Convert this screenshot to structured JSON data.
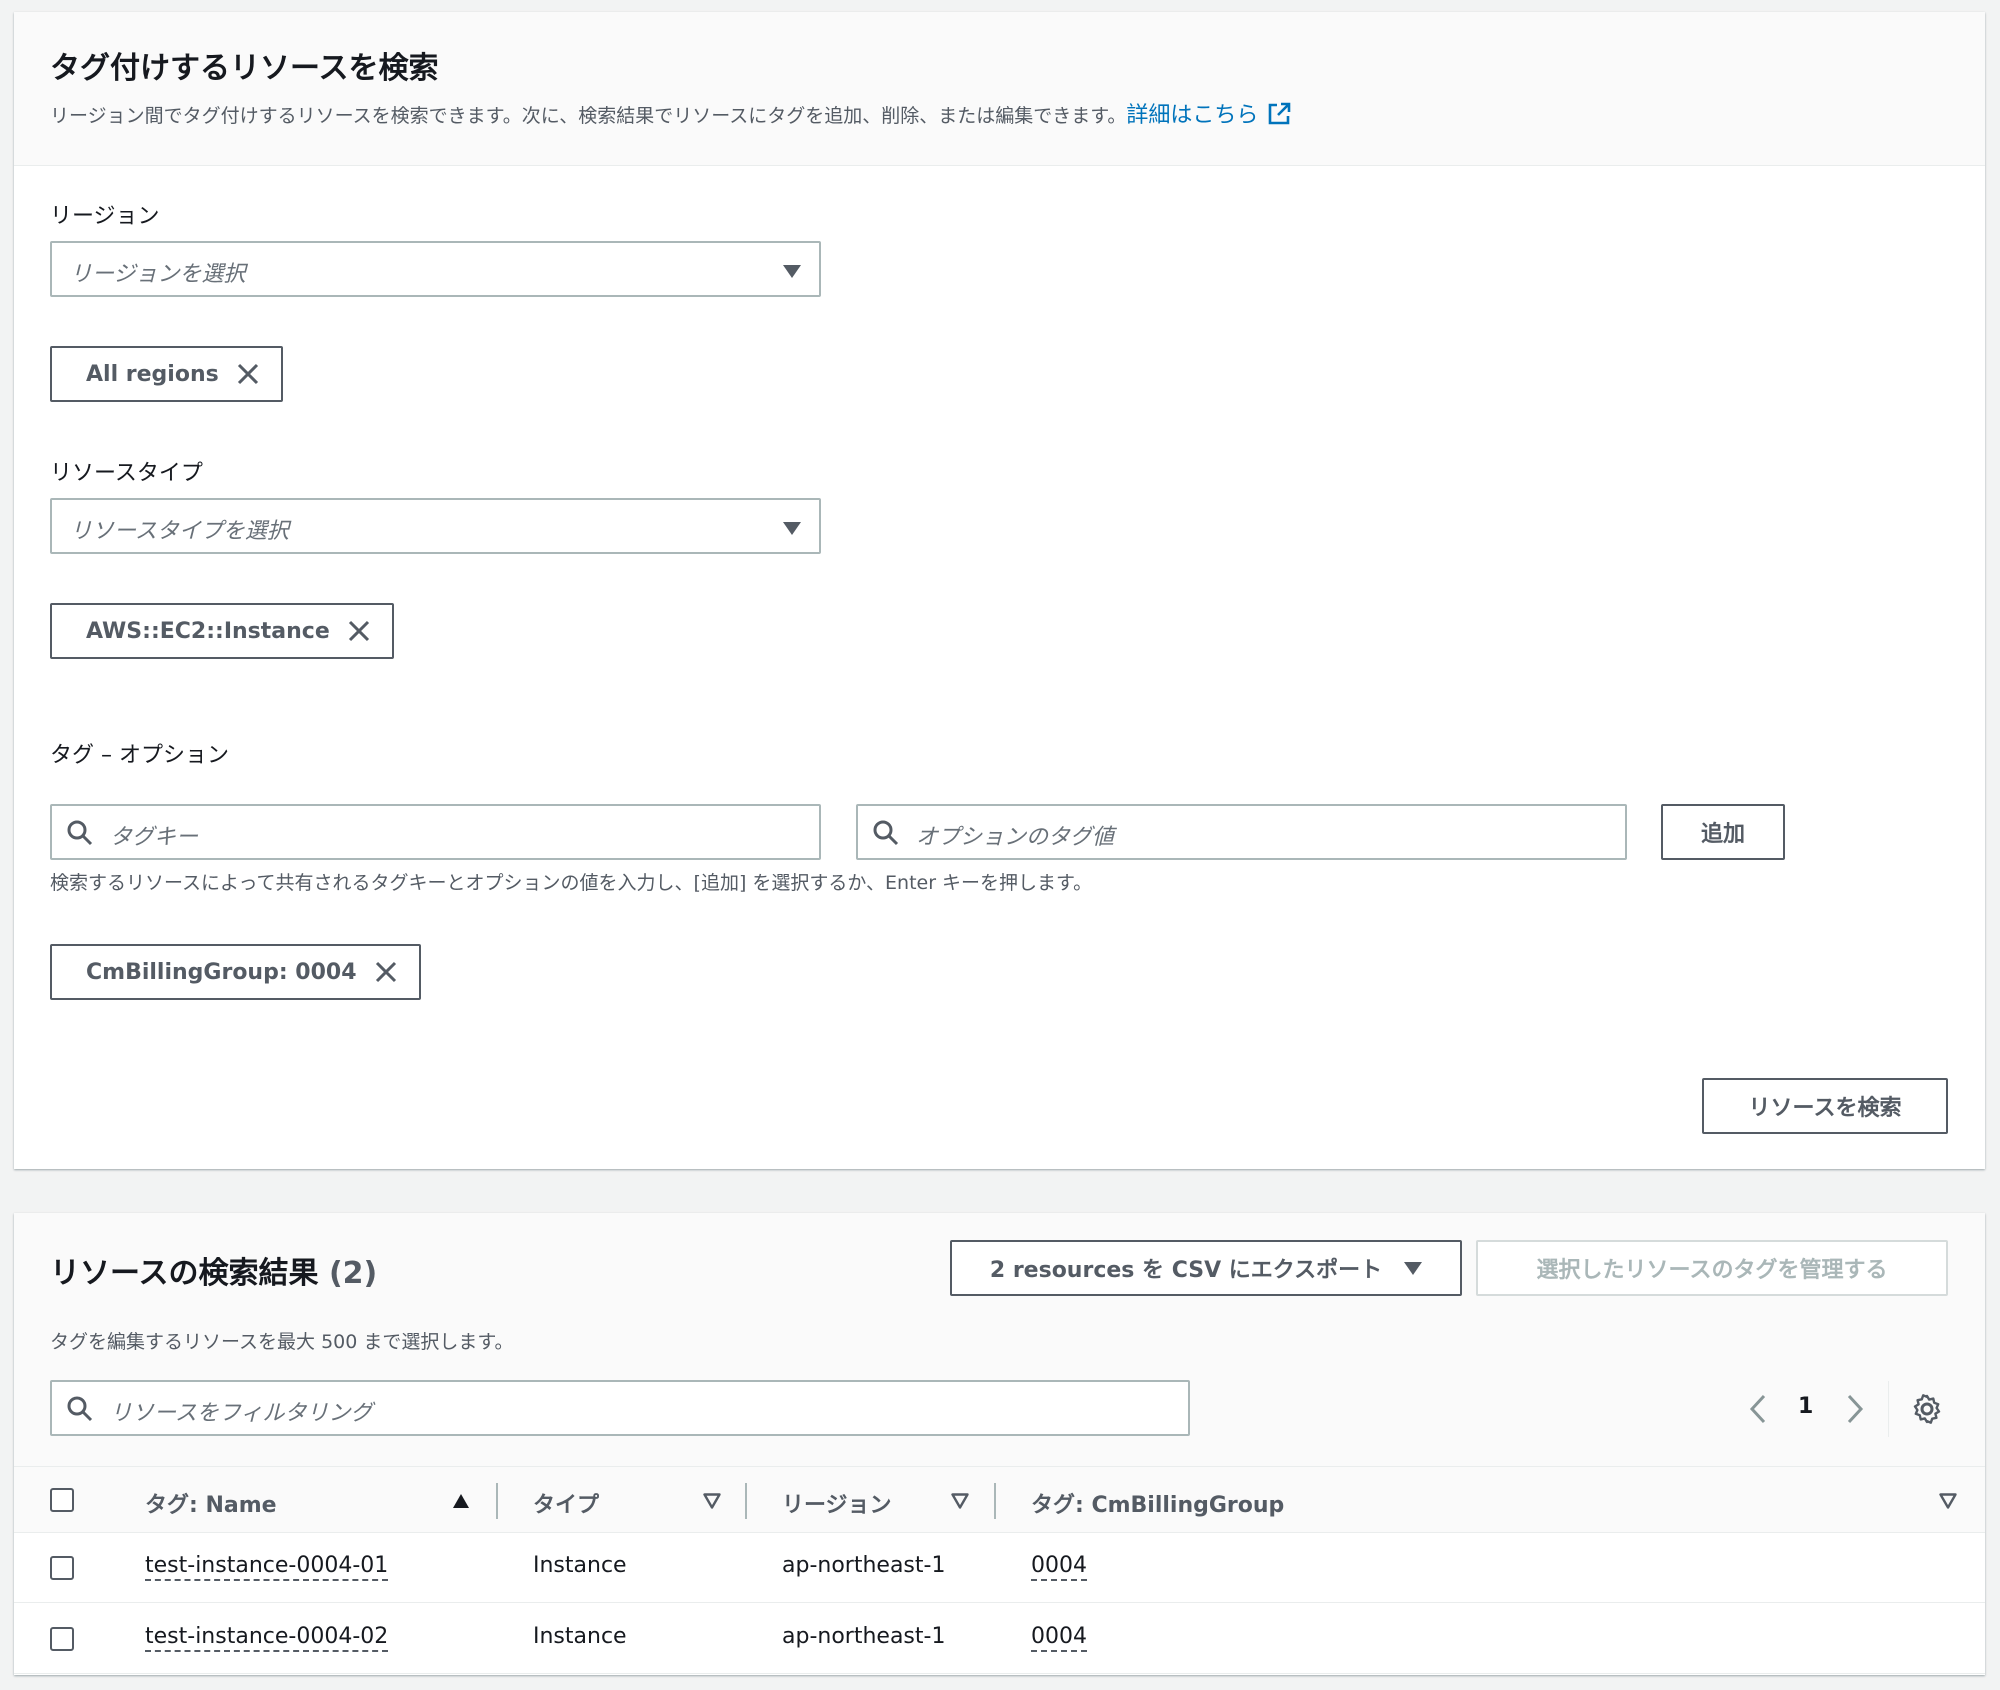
{
  "search_panel": {
    "title": "タグ付けするリソースを検索",
    "description": "リージョン間でタグ付けするリソースを検索できます。次に、検索結果でリソースにタグを追加、削除、または編集できます。",
    "details_link": "詳細はこちら",
    "region_label": "リージョン",
    "region_placeholder": "リージョンを選択",
    "region_token": "All regions",
    "resource_type_label": "リソースタイプ",
    "resource_type_placeholder": "リソースタイプを選択",
    "resource_type_token": "AWS::EC2::Instance",
    "tags_label": "タグ – オプション",
    "tag_key_placeholder": "タグキー",
    "tag_value_placeholder": "オプションのタグ値",
    "add_button": "追加",
    "tag_hint": "検索するリソースによって共有されるタグキーとオプションの値を入力し、[追加] を選択するか、Enter キーを押します。",
    "tag_token": "CmBillingGroup: 0004",
    "search_button": "リソースを検索"
  },
  "results_panel": {
    "title": "リソースの検索結果",
    "count": "(2)",
    "export_button": "2 resources を CSV にエクスポート",
    "manage_tags_button": "選択したリソースのタグを管理する",
    "subtitle": "タグを編集するリソースを最大 500 まで選択します。",
    "filter_placeholder": "リソースをフィルタリング",
    "page": "1",
    "columns": [
      "タグ: Name",
      "タイプ",
      "リージョン",
      "タグ: CmBillingGroup"
    ],
    "rows": [
      {
        "name": "test-instance-0004-01",
        "type": "Instance",
        "region": "ap-northeast-1",
        "billing_group": "0004"
      },
      {
        "name": "test-instance-0004-02",
        "type": "Instance",
        "region": "ap-northeast-1",
        "billing_group": "0004"
      }
    ]
  },
  "colors": {
    "link": "#0073bb",
    "text": "#16191f",
    "secondary_text": "#545b64",
    "border": "#aab7b8",
    "background": "#f2f3f3"
  }
}
